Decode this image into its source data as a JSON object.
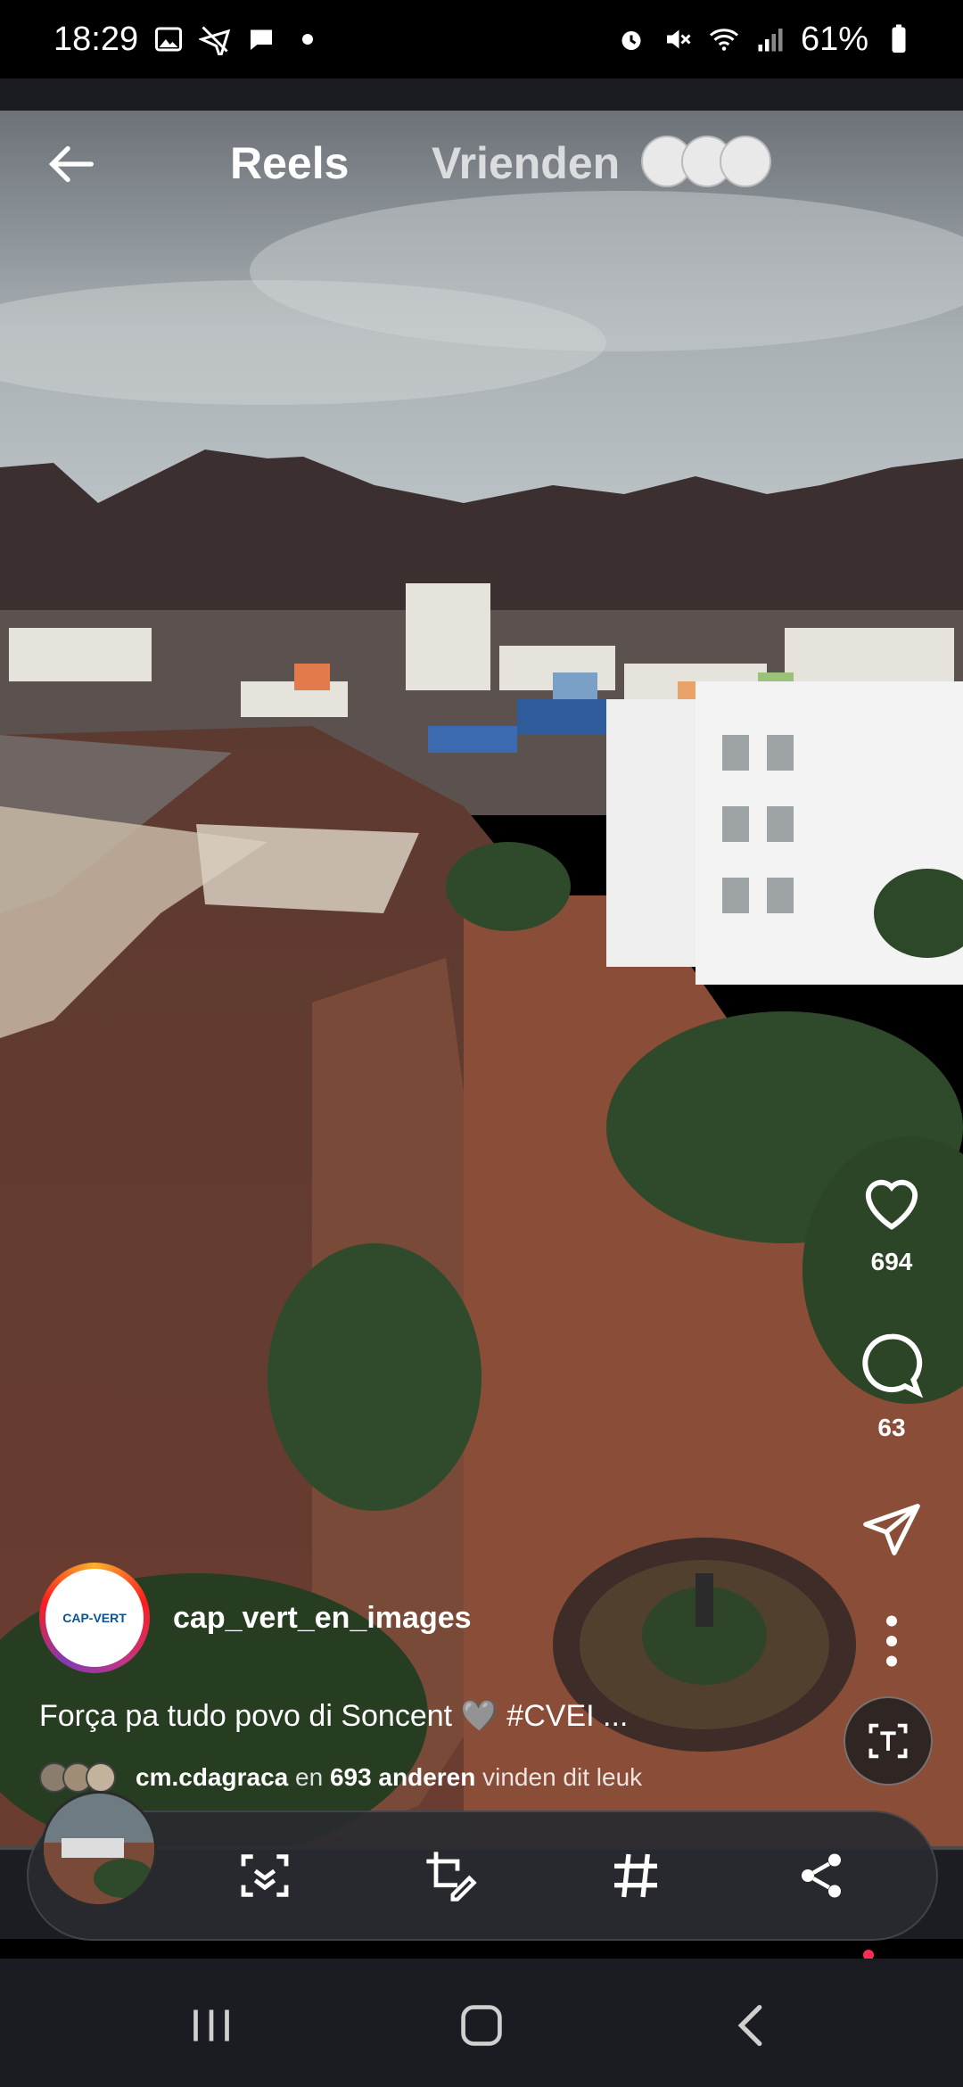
{
  "status_bar": {
    "time": "18:29",
    "battery": "61%",
    "left_icons": [
      "image-icon",
      "no-flight-icon",
      "chat-bubble-icon",
      "dot-icon"
    ],
    "right_icons": [
      "alarm-icon",
      "mute-icon",
      "wifi-icon",
      "signal-icon",
      "battery-icon"
    ]
  },
  "header": {
    "tab_reels": "Reels",
    "tab_friends": "Vrienden"
  },
  "side_actions": {
    "likes_count": "694",
    "comments_count": "63"
  },
  "post": {
    "username": "cap_vert_en_images",
    "avatar_logo_text": "CAP-VERT",
    "caption": "Força pa tudo povo di Soncent 🩶 #CVEI ...",
    "liked_by_user": "cm.cdagraca",
    "liked_by_connector": "en",
    "liked_by_others": "693 anderen",
    "liked_by_suffix": "vinden dit leuk"
  },
  "toolbar": {
    "buttons": [
      "smart-select-icon",
      "crop-draw-icon",
      "hashtag-icon",
      "share-icon"
    ]
  },
  "colors": {
    "accent_notification": "#ff2d55",
    "avatar_ring": "#c13584"
  }
}
